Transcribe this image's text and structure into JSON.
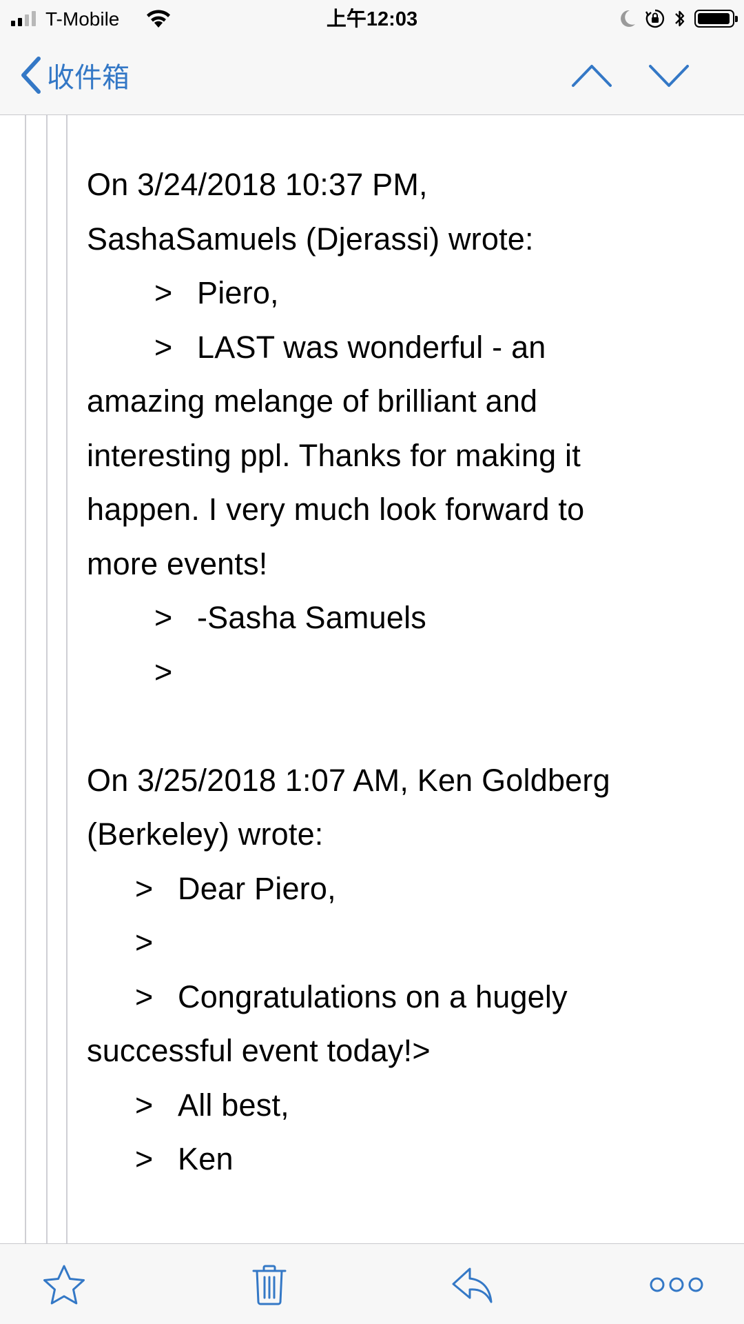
{
  "status_bar": {
    "carrier": "T-Mobile",
    "time": "上午12:03",
    "signal_bars_active": 2,
    "signal_bars_total": 4,
    "battery_level": 0.95,
    "icons": [
      "signal-icon",
      "wifi-icon",
      "moon-icon",
      "orientation-lock-icon",
      "bluetooth-icon",
      "battery-icon"
    ]
  },
  "nav": {
    "back_label": "收件箱",
    "back_icon": "chevron-left-icon",
    "up_icon": "chevron-up-icon",
    "down_icon": "chevron-down-icon",
    "accent_color": "#3478c6"
  },
  "message": {
    "lines": [
      "On 3/24/2018 10:37 PM,",
      "SashaSamuels (Djerassi) wrote:",
      "Piero,",
      "LAST was wonderful - an",
      "amazing melange of brilliant and",
      "interesting ppl. Thanks for making it",
      "happen. I very much look forward to",
      "more events!",
      "-Sasha Samuels",
      "",
      "",
      "On 3/25/2018 1:07 AM, Ken Goldberg",
      "(Berkeley) wrote:",
      "Dear Piero,",
      "",
      "Congratulations on a hugely",
      "successful event today!>",
      "All best,",
      "Ken"
    ],
    "quote_marker": ">"
  },
  "toolbar": {
    "icons": [
      "star-icon",
      "trash-icon",
      "reply-icon",
      "more-icon"
    ],
    "icon_color": "#3478c6"
  }
}
